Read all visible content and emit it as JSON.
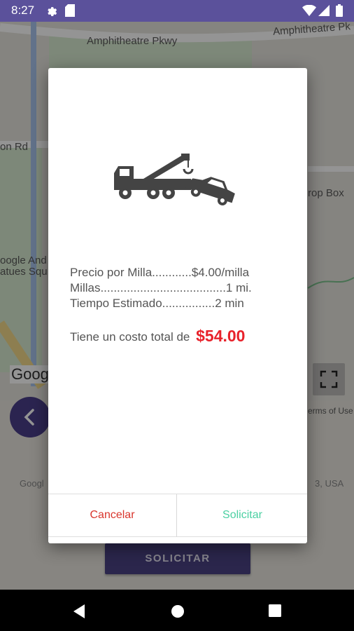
{
  "status_bar": {
    "time": "8:27",
    "background": "#5b519b"
  },
  "map": {
    "labels": {
      "amphitheatre_pkwy": "Amphitheatre Pkwy",
      "amphitheatre_pkwy_right": "Amphitheatre Pk",
      "road_left": "on Rd",
      "drop_box": "rop Box",
      "google_android_1": "oogle And",
      "google_android_2": "atues Squ",
      "google_logo_cut": "Goog",
      "terms": "erms of Use",
      "copyright_left": "Googl",
      "copyright_right": "3, USA"
    }
  },
  "background_controls": {
    "solicitar_label": "SOLICITAR"
  },
  "dialog": {
    "details": {
      "price_per_mile": "Precio por Milla............$4.00/milla",
      "miles": "Millas......................................1 mi.",
      "estimated_time": "Tiempo Estimado................2 min"
    },
    "total_prefix": "Tiene un costo total de",
    "total_amount": "$54.00",
    "buttons": {
      "cancel": "Cancelar",
      "request": "Solicitar"
    },
    "colors": {
      "amount": "#e8222b",
      "cancel": "#d9352c",
      "request": "#4bd0a2"
    }
  }
}
